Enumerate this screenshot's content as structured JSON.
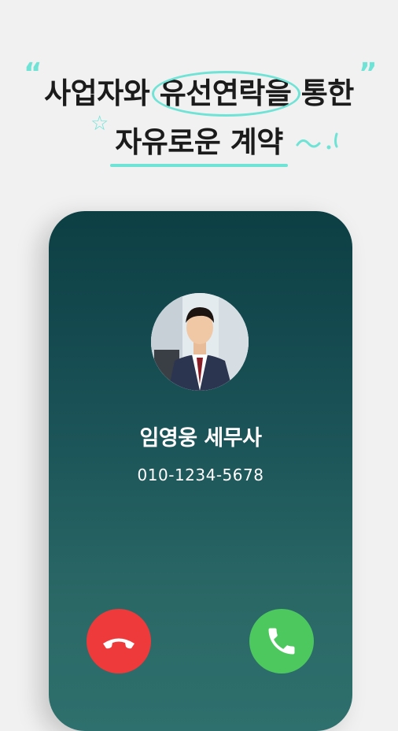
{
  "headline": {
    "line1_prefix": "사업자와 ",
    "line1_highlight": "유선연락을",
    "line1_suffix": " 통한",
    "line2_highlight": "자유로운 계약"
  },
  "call": {
    "caller_name": "임영웅 세무사",
    "caller_number": "010-1234-5678"
  },
  "icons": {
    "decline": "phone-hangup-icon",
    "accept": "phone-answer-icon"
  },
  "colors": {
    "accent": "#6ee3d6",
    "decline": "#ee3a3a",
    "accept": "#4cc85e",
    "screen_top": "#0c3f44",
    "screen_bottom": "#2e706d"
  }
}
